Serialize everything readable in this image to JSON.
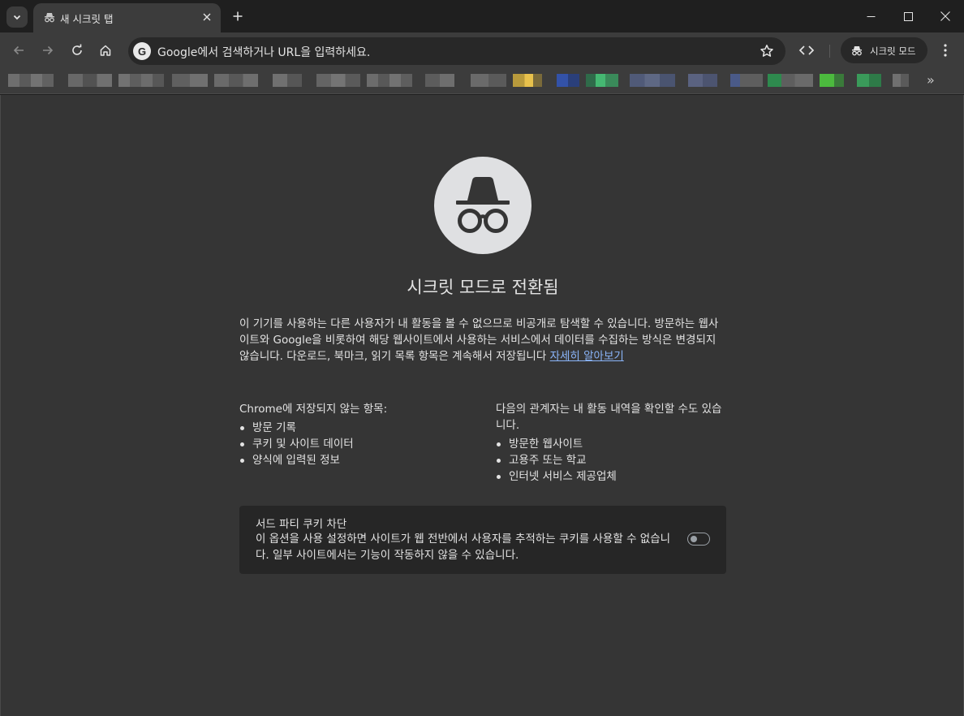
{
  "tab": {
    "title": "새 시크릿 탭"
  },
  "omnibox": {
    "placeholder": "Google에서 검색하거나 URL을 입력하세요."
  },
  "toolbar": {
    "incognito_label": "시크릿 모드"
  },
  "page": {
    "heading": "시크릿 모드로 전환됨",
    "description": "이 기기를 사용하는 다른 사용자가 내 활동을 볼 수 없으므로 비공개로 탐색할 수 있습니다. 방문하는 웹사이트와 Google을 비롯하여 해당 웹사이트에서 사용하는 서비스에서 데이터를 수집하는 방식은 변경되지 않습니다. 다운로드, 북마크, 읽기 목록 항목은 계속해서 저장됩니다",
    "learn_more": "자세히 알아보기",
    "not_saved": {
      "heading": "Chrome에 저장되지 않는 항목:",
      "items": [
        "방문 기록",
        "쿠키 및 사이트 데이터",
        "양식에 입력된 정보"
      ]
    },
    "visible_to": {
      "heading": "다음의 관계자는 내 활동 내역을 확인할 수도 있습니다.",
      "items": [
        "방문한 웹사이트",
        "고용주 또는 학교",
        "인터넷 서비스 제공업체"
      ]
    },
    "cookie": {
      "title": "서드 파티 쿠키 차단",
      "description": "이 옵션을 사용 설정하면 사이트가 웹 전반에서 사용자를 추적하는 쿠키를 사용할 수 없습니다. 일부 사이트에서는 기능이 작동하지 않을 수 있습니다.",
      "enabled": false
    }
  },
  "bookmarks": {
    "more_label": "»"
  },
  "colors": {
    "link": "#8ab4f8",
    "content_bg": "#353535",
    "toolbar_bg": "#3c3c3c"
  }
}
